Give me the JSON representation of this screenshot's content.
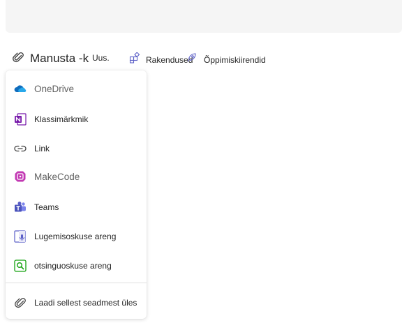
{
  "toolbar": {
    "attach_label": "Manusta -k",
    "new_label": "Uus.",
    "apps_label": "Rakendused",
    "learning_label": "Õppimiskiirendid"
  },
  "menu": {
    "items": [
      {
        "label": "OneDrive",
        "icon": "onedrive-icon"
      },
      {
        "label": "Klassimärkmik",
        "icon": "onenote-icon"
      },
      {
        "label": "Link",
        "icon": "link-icon"
      },
      {
        "label": "MakeCode",
        "icon": "makecode-icon"
      },
      {
        "label": "Teams",
        "icon": "teams-icon"
      },
      {
        "label": "Lugemisoskuse areng",
        "icon": "reading-progress-icon"
      },
      {
        "label": "otsinguoskuse areng",
        "icon": "search-progress-icon"
      },
      {
        "label": "Laadi sellest seadmest üles",
        "icon": "paperclip-icon"
      }
    ]
  },
  "colors": {
    "onedrive": "#0f6cbd",
    "onenote": "#7719aa",
    "makecode": "#c239b3",
    "teams": "#5b5fc7",
    "search_progress": "#13a10e"
  }
}
